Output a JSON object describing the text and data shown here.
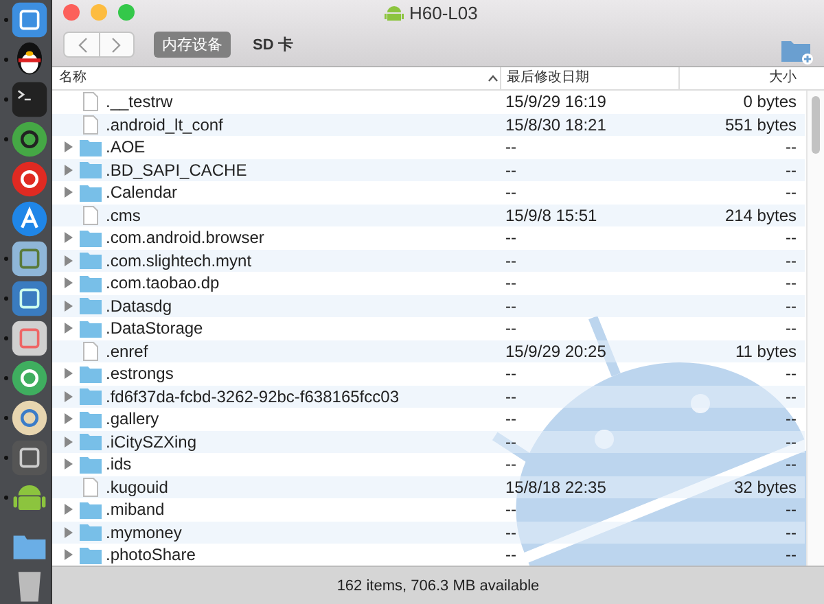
{
  "dock": [
    {
      "running": true
    },
    {
      "running": true
    },
    {
      "running": true
    },
    {
      "running": true
    },
    {
      "running": false
    },
    {
      "running": false
    },
    {
      "running": true
    },
    {
      "running": true
    },
    {
      "running": true
    },
    {
      "running": true
    },
    {
      "running": true
    },
    {
      "running": true
    },
    {
      "running": true
    },
    {
      "running": false
    },
    {
      "running": false
    }
  ],
  "window": {
    "title": "H60-L03"
  },
  "tabs": [
    {
      "label": "内存设备",
      "selected": true
    },
    {
      "label": "SD 卡",
      "selected": false
    }
  ],
  "table": {
    "columns": [
      "名称",
      "最后修改日期",
      "大小"
    ],
    "rows": [
      {
        "kind": "file",
        "name": ".__testrw",
        "modified": "15/9/29 16:19",
        "size": "0 bytes"
      },
      {
        "kind": "file",
        "name": ".android_lt_conf",
        "modified": "15/8/30 18:21",
        "size": "551 bytes"
      },
      {
        "kind": "folder",
        "expanded": false,
        "name": ".AOE",
        "modified": "--",
        "size": "--"
      },
      {
        "kind": "folder",
        "expanded": false,
        "name": ".BD_SAPI_CACHE",
        "modified": "--",
        "size": "--"
      },
      {
        "kind": "folder",
        "expanded": false,
        "name": ".Calendar",
        "modified": "--",
        "size": "--"
      },
      {
        "kind": "file",
        "name": ".cms",
        "modified": "15/9/8 15:51",
        "size": "214 bytes"
      },
      {
        "kind": "folder",
        "expanded": false,
        "name": ".com.android.browser",
        "modified": "--",
        "size": "--"
      },
      {
        "kind": "folder",
        "expanded": false,
        "name": ".com.slightech.mynt",
        "modified": "--",
        "size": "--"
      },
      {
        "kind": "folder",
        "expanded": false,
        "name": ".com.taobao.dp",
        "modified": "--",
        "size": "--"
      },
      {
        "kind": "folder",
        "expanded": false,
        "name": ".Datasdg",
        "modified": "--",
        "size": "--"
      },
      {
        "kind": "folder",
        "expanded": false,
        "name": ".DataStorage",
        "modified": "--",
        "size": "--"
      },
      {
        "kind": "file",
        "name": ".enref",
        "modified": "15/9/29 20:25",
        "size": "11 bytes"
      },
      {
        "kind": "folder",
        "expanded": false,
        "name": ".estrongs",
        "modified": "--",
        "size": "--"
      },
      {
        "kind": "folder",
        "expanded": false,
        "name": ".fd6f37da-fcbd-3262-92bc-f638165fcc03",
        "modified": "--",
        "size": "--"
      },
      {
        "kind": "folder",
        "expanded": false,
        "name": ".gallery",
        "modified": "--",
        "size": "--"
      },
      {
        "kind": "folder",
        "expanded": false,
        "name": ".iCitySZXing",
        "modified": "--",
        "size": "--"
      },
      {
        "kind": "folder",
        "expanded": false,
        "name": ".ids",
        "modified": "--",
        "size": "--"
      },
      {
        "kind": "file",
        "name": ".kugouid",
        "modified": "15/8/18 22:35",
        "size": "32 bytes"
      },
      {
        "kind": "folder",
        "expanded": false,
        "name": ".miband",
        "modified": "--",
        "size": "--"
      },
      {
        "kind": "folder",
        "expanded": false,
        "name": ".mymoney",
        "modified": "--",
        "size": "--"
      },
      {
        "kind": "folder",
        "expanded": false,
        "name": ".photoShare",
        "modified": "--",
        "size": "--"
      }
    ]
  },
  "status_bar": "162 items, 706.3 MB available"
}
